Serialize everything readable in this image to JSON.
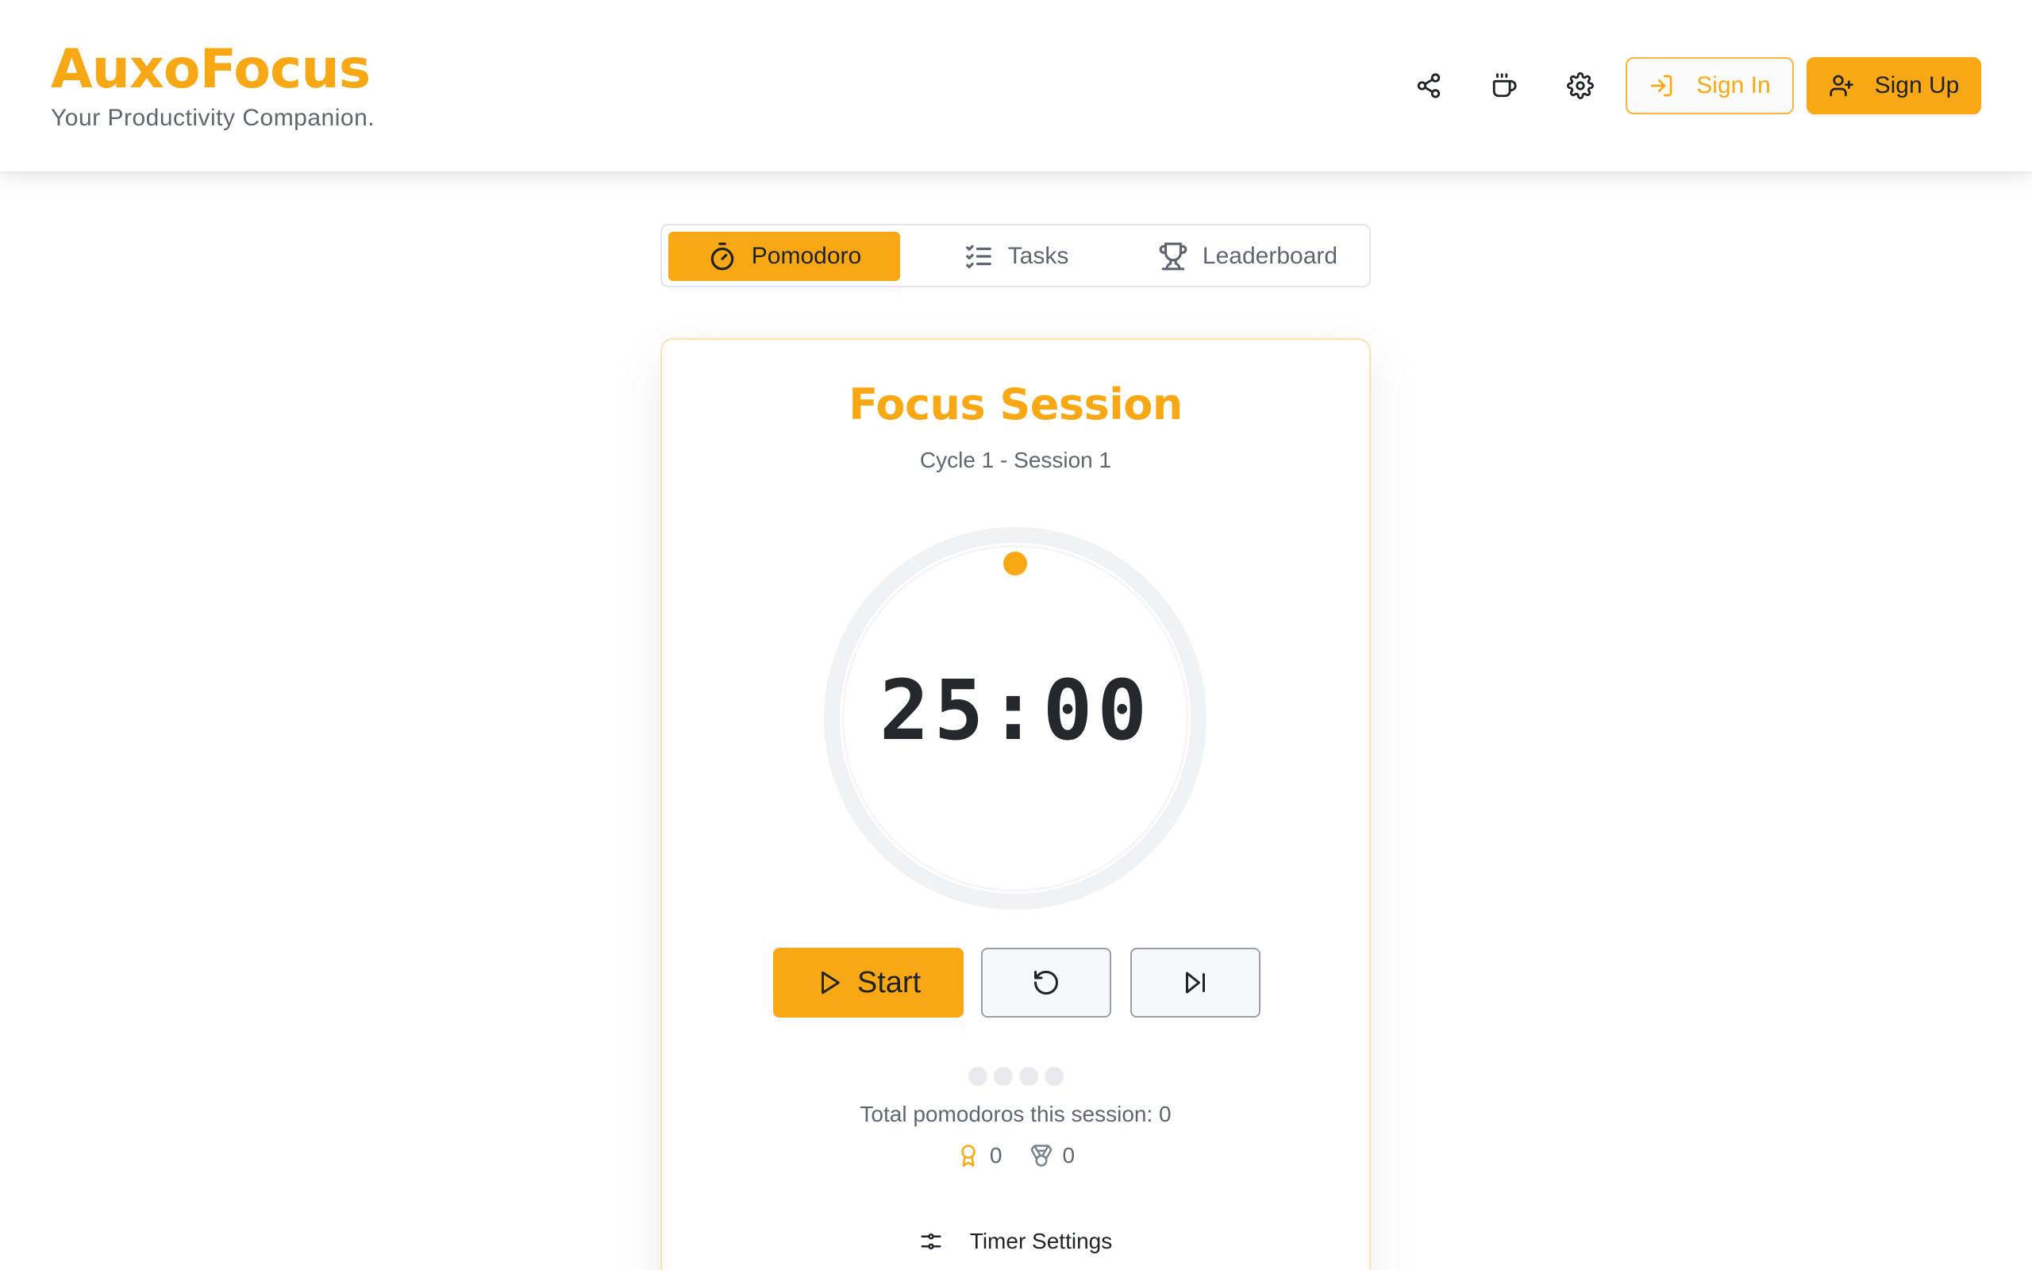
{
  "app": {
    "title": "AuxoFocus",
    "tagline": "Your Productivity Companion."
  },
  "header": {
    "icons": [
      "share-icon",
      "coffee-icon",
      "gear-icon"
    ],
    "signin_label": "Sign In",
    "signup_label": "Sign Up"
  },
  "tabs": [
    {
      "label": "Pomodoro",
      "icon": "timer-icon",
      "active": true
    },
    {
      "label": "Tasks",
      "icon": "checklist-icon",
      "active": false
    },
    {
      "label": "Leaderboard",
      "icon": "trophy-icon",
      "active": false
    }
  ],
  "session": {
    "title": "Focus Session",
    "subtitle": "Cycle 1 - Session 1",
    "timer": "25:00",
    "progress": 0,
    "start_label": "Start",
    "cycle_dots_total": 4,
    "cycle_dots_completed": 0,
    "total_text": "Total pomodoros this session: 0",
    "awards": [
      {
        "icon": "award-icon",
        "value": "0"
      },
      {
        "icon": "medal-icon",
        "value": "0"
      }
    ],
    "settings_label": "Timer Settings"
  },
  "colors": {
    "accent": "#f9a815",
    "text": "#1f2328",
    "muted": "#5f6670",
    "ring_track": "#f1f2f4"
  }
}
